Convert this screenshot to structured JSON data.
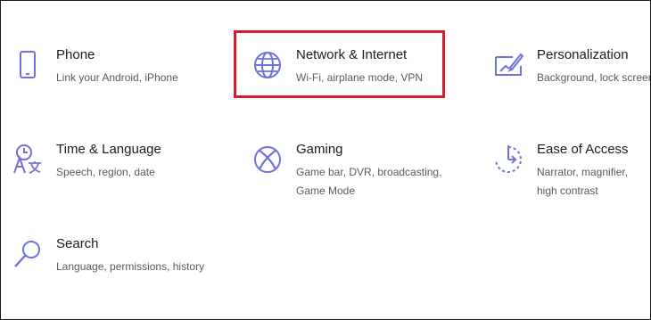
{
  "categories": [
    {
      "id": "phone",
      "icon": "phone-icon",
      "title": "Phone",
      "desc": "Link your Android, iPhone"
    },
    {
      "id": "network",
      "icon": "globe-icon",
      "title": "Network & Internet",
      "desc": "Wi-Fi, airplane mode, VPN",
      "highlighted": true
    },
    {
      "id": "personalization",
      "icon": "personalization-icon",
      "title": "Personalization",
      "desc": "Background, lock screen, colors"
    },
    {
      "id": "time",
      "icon": "time-language-icon",
      "title": "Time & Language",
      "desc": "Speech, region, date"
    },
    {
      "id": "gaming",
      "icon": "xbox-icon",
      "title": "Gaming",
      "desc": "Game bar, DVR, broadcasting, Game Mode"
    },
    {
      "id": "ease",
      "icon": "ease-of-access-icon",
      "title": "Ease of Access",
      "desc": "Narrator, magnifier, high contrast"
    },
    {
      "id": "search",
      "icon": "search-icon",
      "title": "Search",
      "desc": "Language, permissions, history"
    }
  ],
  "theme": {
    "icon_color": "#6f72d9",
    "highlight_color": "#d0202e"
  }
}
